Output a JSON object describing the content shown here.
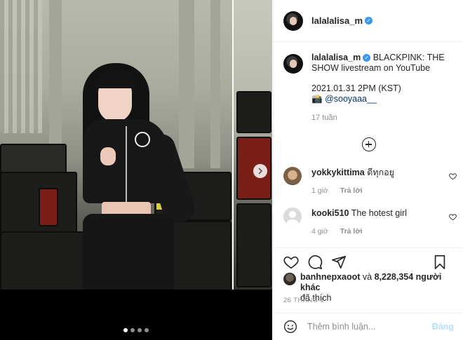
{
  "post": {
    "username": "lalalalisa_m",
    "caption_line1": "BLACKPINK: THE SHOW livestream on YouTube",
    "caption_line2": "2021.01.31 2PM (KST)",
    "caption_camera": "📸",
    "caption_mention": "@sooyaaa__",
    "time_ago": "17 tuần"
  },
  "comments": [
    {
      "username": "yokkykittima",
      "text": "ดีทุกอยู",
      "time": "1 giờ",
      "reply_label": "Trả lời"
    },
    {
      "username": "kooki510",
      "text": "The hotest girl",
      "time": "4 giờ",
      "reply_label": "Trả lời"
    }
  ],
  "likes": {
    "liker": "banhnepxaoot",
    "connector": "và",
    "count_text": "8,228,354 người khác",
    "suffix": "đã thích"
  },
  "date": "26 THÁNG 1",
  "add_comment": {
    "placeholder": "Thêm bình luận...",
    "post_label": "Đăng"
  },
  "carousel": {
    "total": 4,
    "current": 1
  },
  "colors": {
    "link": "#00376b",
    "verified": "#3897f0",
    "post_disabled": "#b2dffc",
    "muted": "#8e8e8e"
  }
}
